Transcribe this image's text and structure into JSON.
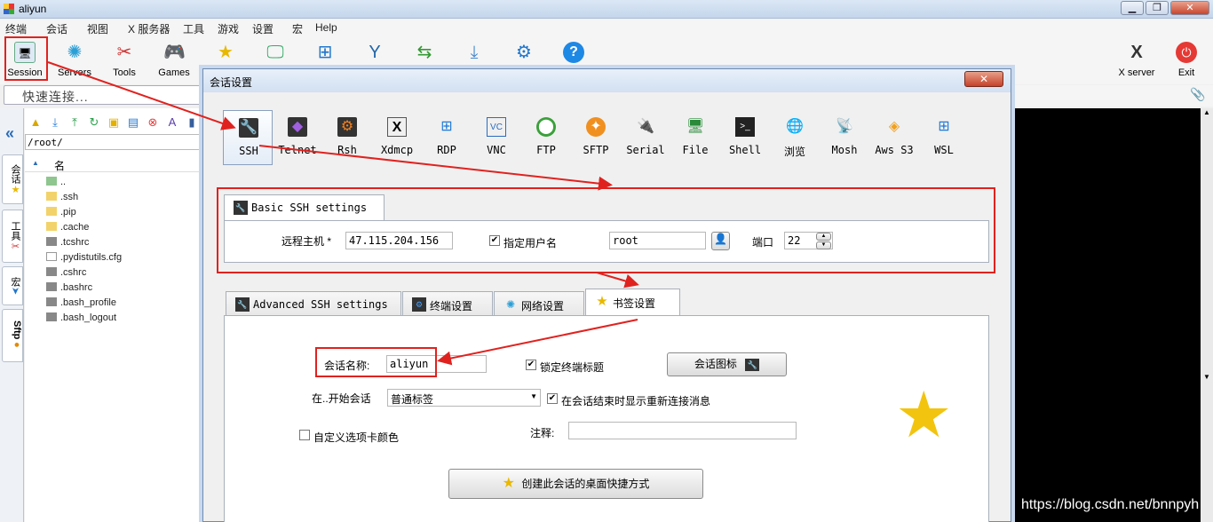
{
  "window": {
    "title": "aliyun",
    "min": "▁",
    "max": "❐",
    "close": "✕"
  },
  "menu": [
    "终端",
    "会话",
    "视图",
    "X 服务器",
    "工具",
    "游戏",
    "设置",
    "宏",
    "Help"
  ],
  "toolbar": {
    "items": [
      {
        "label": "Session",
        "icon": "session-icon"
      },
      {
        "label": "Servers",
        "icon": "servers-icon"
      },
      {
        "label": "Tools",
        "icon": "tools-icon"
      },
      {
        "label": "Games",
        "icon": "games-icon"
      }
    ],
    "xserver_label": "X server",
    "exit_label": "Exit"
  },
  "quick_connect": {
    "placeholder": "快速连接..."
  },
  "side_tabs": [
    "会话",
    "工具",
    "宏",
    "Sftp"
  ],
  "sftp": {
    "path": "/root/",
    "column_name": "名",
    "files": [
      "..",
      ".ssh",
      ".pip",
      ".cache",
      ".tcshrc",
      ".pydistutils.cfg",
      ".cshrc",
      ".bashrc",
      ".bash_profile",
      ".bash_logout"
    ]
  },
  "watermark": "https://blog.csdn.net/bnnpyh",
  "dialog": {
    "title": "会话设置",
    "close": "✕",
    "session_types": [
      "SSH",
      "Telnet",
      "Rsh",
      "Xdmcp",
      "RDP",
      "VNC",
      "FTP",
      "SFTP",
      "Serial",
      "File",
      "Shell",
      "浏览",
      "Mosh",
      "Aws S3",
      "WSL"
    ],
    "basic_tab": "Basic SSH settings",
    "remote_host_label": "远程主机 *",
    "remote_host": "47.115.204.156",
    "specify_user_label": "指定用户名",
    "specify_user_checked": true,
    "username": "root",
    "port_label": "端口",
    "port": "22",
    "tabs": [
      "Advanced SSH settings",
      "终端设置",
      "网络设置",
      "书签设置"
    ],
    "active_tab": "书签设置",
    "session_name_label": "会话名称:",
    "session_name": "aliyun",
    "lock_title_label": "锁定终端标题",
    "lock_title_checked": true,
    "session_icon_button": "会话图标",
    "start_in_label": "在..开始会话",
    "start_in_value": "普通标签",
    "reconnect_msg_label": "在会话结束时显示重新连接消息",
    "reconnect_checked": true,
    "custom_color_label": "自定义选项卡颜色",
    "custom_color_checked": false,
    "comment_label": "注释:",
    "comment_value": "",
    "shortcut_button": "创建此会话的桌面快捷方式"
  },
  "colors": {
    "annotation_red": "#e0221f",
    "star": "#f2c40f"
  }
}
